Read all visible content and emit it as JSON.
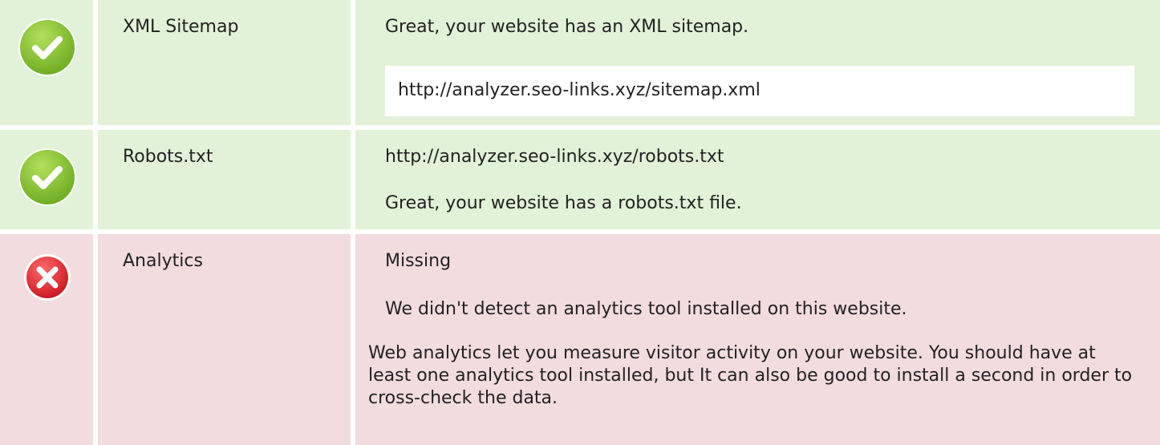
{
  "rows": [
    {
      "status": "pass",
      "icon": "check-icon",
      "label": "XML Sitemap",
      "message": "Great, your website has an XML sitemap.",
      "url": "http://analyzer.seo-links.xyz/sitemap.xml"
    },
    {
      "status": "pass",
      "icon": "check-icon",
      "label": "Robots.txt",
      "url": "http://analyzer.seo-links.xyz/robots.txt",
      "message": "Great, your website has a robots.txt file."
    },
    {
      "status": "fail",
      "icon": "error-icon",
      "label": "Analytics",
      "result": "Missing",
      "message": "We didn't detect an analytics tool installed on this website.",
      "description": "Web analytics let you measure visitor activity on your website. You should have at least one analytics tool installed, but It can also be good to install a second in order to cross-check the data."
    }
  ],
  "colors": {
    "pass_background": "#e1f2d8",
    "fail_background": "#f2dcde",
    "pass_icon": "#8cc63f",
    "fail_icon": "#e0242c"
  }
}
